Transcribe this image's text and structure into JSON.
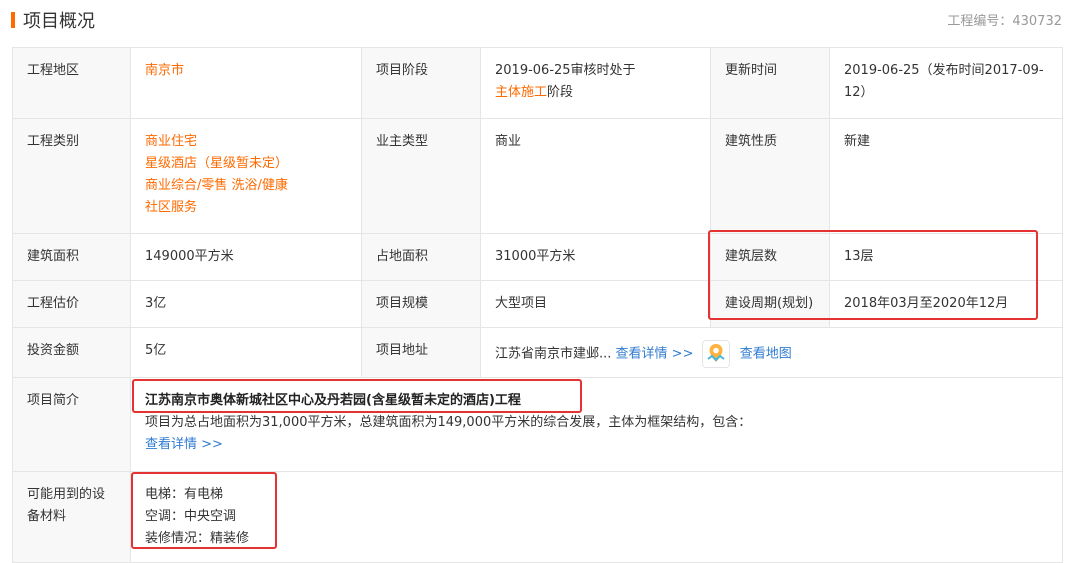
{
  "header": {
    "title": "项目概况",
    "code_label": "工程编号：430732"
  },
  "rows": {
    "r1": {
      "l1": "工程地区",
      "v1": "南京市",
      "l2": "项目阶段",
      "v2_pre": "2019-06-25审核时处于",
      "v2_link": "主体施工",
      "v2_post": "阶段",
      "l3": "更新时间",
      "v3": "2019-06-25（发布时间2017-09-12）"
    },
    "r2": {
      "l1": "工程类别",
      "v1_lines": [
        "商业住宅",
        "星级酒店（星级暂未定）",
        "商业综合/零售 洗浴/健康",
        "社区服务"
      ],
      "l2": "业主类型",
      "v2": "商业",
      "l3": "建筑性质",
      "v3": "新建"
    },
    "r3": {
      "l1": "建筑面积",
      "v1": "149000平方米",
      "l2": "占地面积",
      "v2": "31000平方米",
      "l3": "建筑层数",
      "v3": "13层"
    },
    "r4": {
      "l1": "工程估价",
      "v1": "3亿",
      "l2": "项目规模",
      "v2": "大型项目",
      "l3": "建设周期(规划)",
      "v3": "2018年03月至2020年12月"
    },
    "r5": {
      "l1": "投资金额",
      "v1": "5亿",
      "l2": "项目地址",
      "addr": "江苏省南京市建邺...",
      "detail": "查看详情 >>",
      "map": "查看地图"
    },
    "r6": {
      "l1": "项目简介",
      "title": "江苏南京市奥体新城社区中心及丹若园(含星级暂未定的酒店)工程",
      "desc": "项目为总占地面积为31,000平方米，总建筑面积为149,000平方米的综合发展，主体为框架结构，包含：",
      "detail": "查看详情 >>"
    },
    "r7": {
      "l1": "可能用到的设备材料",
      "items": [
        "电梯：有电梯",
        "空调：中央空调",
        "装修情况：精装修"
      ]
    }
  },
  "colors": {
    "accent": "#ff6a00",
    "link": "#2f7bd1",
    "highlight": "#e53333"
  },
  "icons": {
    "map": "map-pin-icon"
  }
}
